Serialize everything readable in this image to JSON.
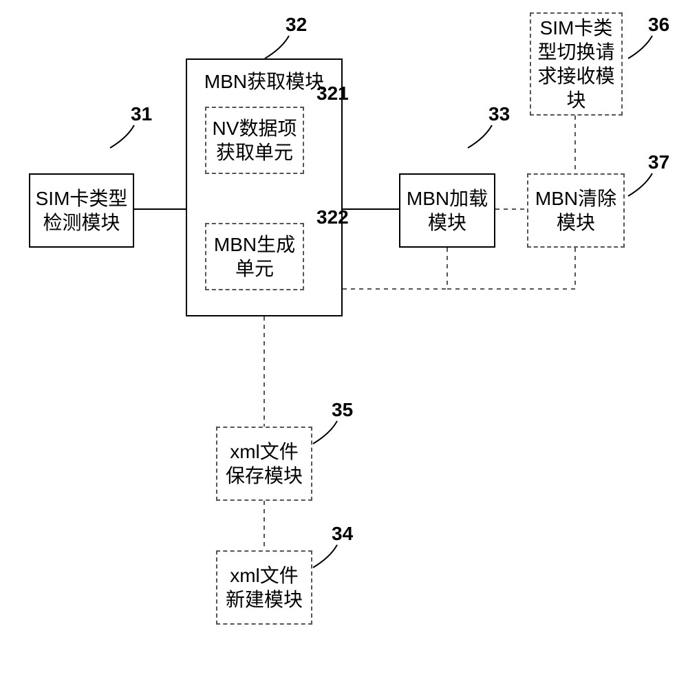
{
  "boxes": {
    "sim_detect": {
      "label": "SIM卡类型\n检测模块",
      "num": "31"
    },
    "mbn_acquire": {
      "label": "MBN获取模块",
      "num": "32"
    },
    "nv_unit": {
      "label": "NV数据项\n获取单元",
      "num": "321"
    },
    "mbn_gen_unit": {
      "label": "MBN生成\n单元",
      "num": "322"
    },
    "mbn_load": {
      "label": "MBN加载\n模块",
      "num": "33"
    },
    "xml_new": {
      "label": "xml文件\n新建模块",
      "num": "34"
    },
    "xml_save": {
      "label": "xml文件\n保存模块",
      "num": "35"
    },
    "sim_switch": {
      "label": "SIM卡类\n型切换请\n求接收模\n块",
      "num": "36"
    },
    "mbn_clear": {
      "label": "MBN清除\n模块",
      "num": "37"
    }
  }
}
